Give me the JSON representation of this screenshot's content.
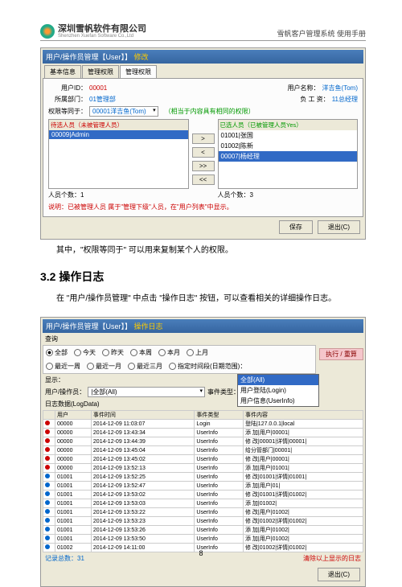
{
  "header": {
    "company_cn": "深圳雪帆软件有限公司",
    "company_en": "Shenzhen Xuefan Software Co.,Ltd",
    "right": "雪帆客户管理系统 使用手册"
  },
  "shot1": {
    "title_a": "用户/操作员管理【User】】",
    "title_b": "修改",
    "tabs": [
      "基本信息",
      "管理权限",
      "管理权限"
    ],
    "lbl_userid": "用户ID：",
    "val_userid": "00001",
    "lbl_username": "用户名称：",
    "val_username": "洋吉鱼(Tom)",
    "lbl_dept": "所属部门：",
    "val_dept": "01管理部",
    "lbl_job": "负 工 资：",
    "val_job": "11总经理",
    "lbl_perm": "权限等同于：",
    "val_perm": "00001洋吉鱼(Tom)",
    "perm_hint": "（相当于内容具有相同的权限）",
    "left_hdr": "待选人员（未被管理人员）",
    "left_item": "00009|Admin",
    "right_hdr": "已选人员（已被管理人员Yes）",
    "right_items": [
      "01001|张国",
      "01002|陈新",
      "00007|杨经理"
    ],
    "btns": [
      ">",
      "<",
      ">>",
      "<<"
    ],
    "count_l": "人员个数：1",
    "count_r": "人员个数：3",
    "note": "说明：已被管理人员 属于\"管理下级\"人员，在\"用户列表\"中显示。",
    "save": "保存",
    "close": "退出(C)"
  },
  "text1": "其中，\"权限等同于\" 可以用来复制某个人的权限。",
  "sec": "3.2  操作日志",
  "text2": "在 \"用户/操作员管理\" 中点击 \"操作日志\" 按钮，可以查看相关的详细操作日志。",
  "shot2": {
    "title_a": "用户/操作员管理【User】】",
    "title_b": "操作日志",
    "search": "查询",
    "radios": [
      "全部",
      "今天",
      "昨天",
      "本周",
      "本月",
      "上月"
    ],
    "radios2": [
      "最近一周",
      "最近一月",
      "最近三月",
      "指定时间段(日期范围)："
    ],
    "exec": "执行 / 重算",
    "show": "显示：",
    "lbl_user": "用户/操作员：",
    "val_user": "|全部(All)",
    "lbl_type": "事件类型：",
    "val_type": "|全部(All)",
    "dd": [
      "全部(All)",
      "用户登陆(Login)",
      "用户信息(UserInfo)"
    ],
    "grid_title": "日志数据(LogData)",
    "cols": [
      "",
      "用户",
      "事件时间",
      "事件类型",
      "事件内容"
    ],
    "rows": [
      [
        "r",
        "00000",
        "2014-12-09 11:03:07",
        "Login",
        "登陆|127.0.0.1|local"
      ],
      [
        "r",
        "00000",
        "2014-12-09 13:43:34",
        "UserInfo",
        "添 加|用户|00001|"
      ],
      [
        "r",
        "00000",
        "2014-12-09 13:44:39",
        "UserInfo",
        "修 改|00001|详情|00001|"
      ],
      [
        "r",
        "00000",
        "2014-12-09 13:45:04",
        "UserInfo",
        "给分管部门|00001|"
      ],
      [
        "r",
        "00000",
        "2014-12-09 13:45:02",
        "UserInfo",
        "修 改|用户|00001|"
      ],
      [
        "r",
        "00000",
        "2014-12-09 13:52:13",
        "UserInfo",
        "添 加|用户|01001|"
      ],
      [
        "b",
        "01001",
        "2014-12-09 13:52:25",
        "UserInfo",
        "修 改|01001|详情|01001|"
      ],
      [
        "b",
        "01001",
        "2014-12-09 13:52:47",
        "UserInfo",
        "添 加|用户|01|"
      ],
      [
        "b",
        "01001",
        "2014-12-09 13:53:02",
        "UserInfo",
        "修 改|01001|详情|01002|"
      ],
      [
        "b",
        "01001",
        "2014-12-09 13:53:03",
        "UserInfo",
        "添 加|01002|"
      ],
      [
        "b",
        "01001",
        "2014-12-09 13:53:22",
        "UserInfo",
        "修 改|用户|01002|"
      ],
      [
        "b",
        "01001",
        "2014-12-09 13:53:23",
        "UserInfo",
        "修 改|01002|详情|01002|"
      ],
      [
        "b",
        "01001",
        "2014-12-09 13:53:26",
        "UserInfo",
        "添 加|用户|01002|"
      ],
      [
        "b",
        "01001",
        "2014-12-09 13:53:50",
        "UserInfo",
        "添 加|用户|01002|"
      ],
      [
        "b",
        "01002",
        "2014-12-09 14:11:00",
        "UserInfo",
        "修 改|01002|详情|01002|"
      ]
    ],
    "rec": "记录总数：31",
    "clear": "清除以上显示的日志",
    "close": "退出(C)"
  },
  "page": "8"
}
